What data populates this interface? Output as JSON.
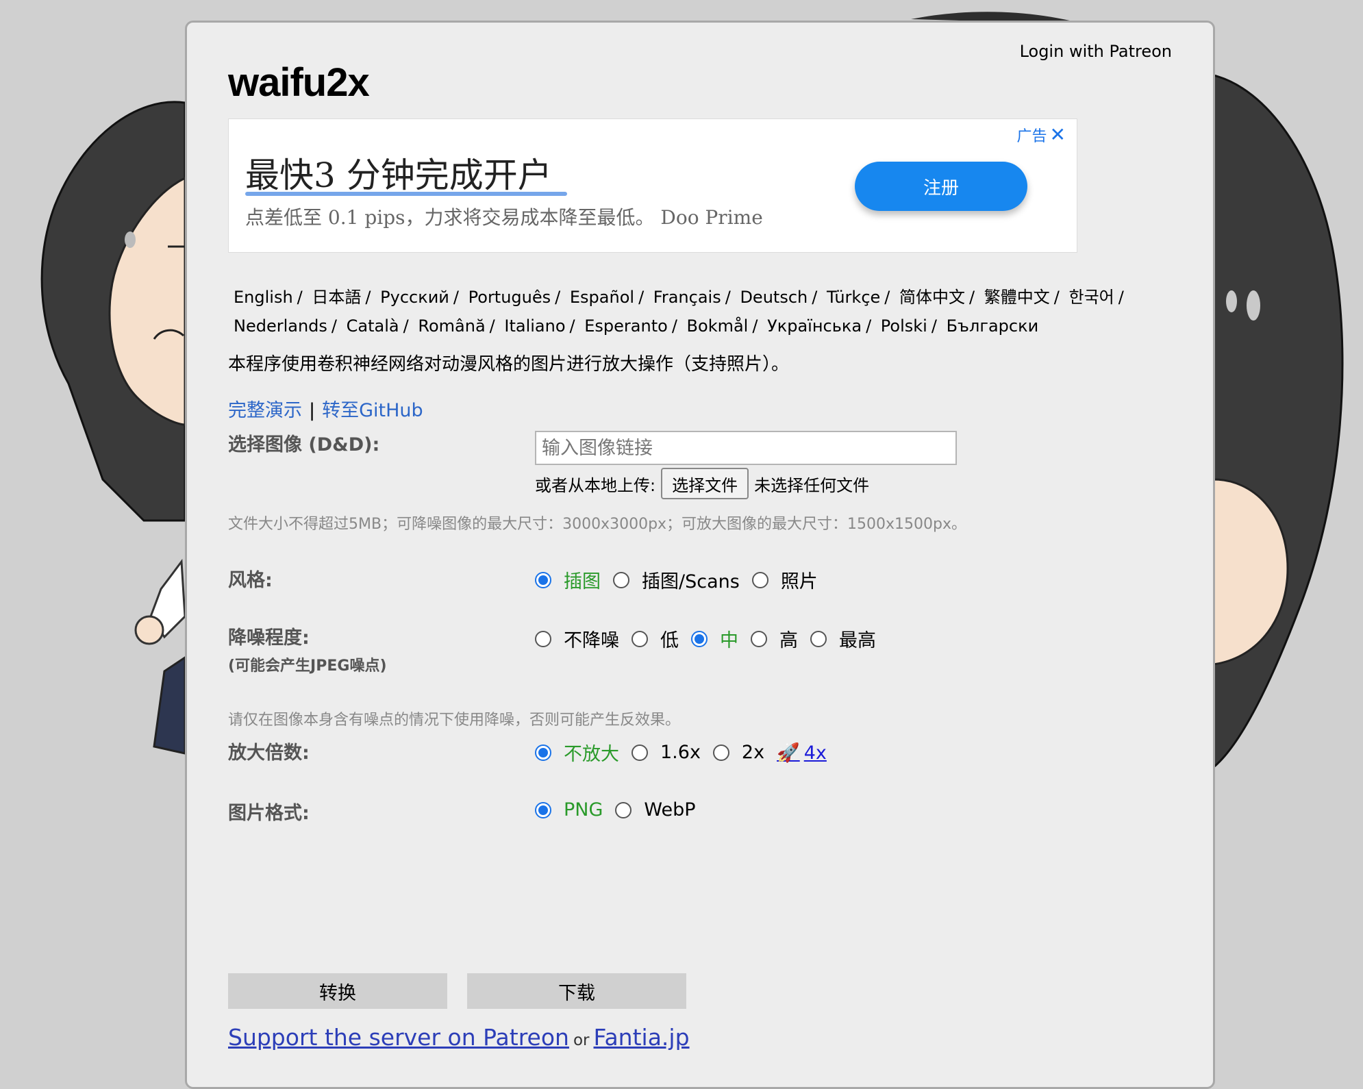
{
  "header": {
    "login_label": "Login with Patreon",
    "logo_text": "waifu2x"
  },
  "ad": {
    "tag_label": "广告",
    "close_glyph": "✕",
    "headline": "最快3 分钟完成开户",
    "subline": "点差低至 0.1 pips，力求将交易成本降至最低。 Doo Prime",
    "cta_label": "注册",
    "cta_color": "#1787ef"
  },
  "languages": [
    "English",
    "日本語",
    "Русский",
    "Português",
    "Español",
    "Français",
    "Deutsch",
    "Türkçe",
    "简体中文",
    "繁體中文",
    "한국어",
    "Nederlands",
    "Català",
    "Română",
    "Italiano",
    "Esperanto",
    "Bokmål",
    "Українська",
    "Polski",
    "Български"
  ],
  "description": "本程序使用卷积神经网络对动漫风格的图片进行放大操作（支持照片）。",
  "links": {
    "demo": "完整演示",
    "separator": "|",
    "github": "转至GitHub"
  },
  "image_select": {
    "label": "选择图像 (D&D):",
    "url_placeholder": "输入图像链接",
    "upload_prefix": "或者从本地上传:",
    "file_button": "选择文件",
    "file_status": "未选择任何文件",
    "limits_note": "文件大小不得超过5MB；可降噪图像的最大尺寸：3000x3000px；可放大图像的最大尺寸：1500x1500px。"
  },
  "style": {
    "label": "风格:",
    "options": [
      {
        "label": "插图",
        "selected": true
      },
      {
        "label": "插图/Scans",
        "selected": false
      },
      {
        "label": "照片",
        "selected": false
      }
    ]
  },
  "noise": {
    "label": "降噪程度:",
    "sublabel": "(可能会产生JPEG噪点)",
    "options": [
      {
        "label": "不降噪",
        "selected": false
      },
      {
        "label": "低",
        "selected": false
      },
      {
        "label": "中",
        "selected": true
      },
      {
        "label": "高",
        "selected": false
      },
      {
        "label": "最高",
        "selected": false
      }
    ],
    "note": "请仅在图像本身含有噪点的情况下使用降噪，否则可能产生反效果。"
  },
  "scale": {
    "label": "放大倍数:",
    "options": [
      {
        "label": "不放大",
        "selected": true
      },
      {
        "label": "1.6x",
        "selected": false
      },
      {
        "label": "2x",
        "selected": false
      }
    ],
    "premium_glyph": "🚀",
    "premium_label": "4x"
  },
  "format": {
    "label": "图片格式:",
    "options": [
      {
        "label": "PNG",
        "selected": true
      },
      {
        "label": "WebP",
        "selected": false
      }
    ]
  },
  "actions": {
    "convert": "转换",
    "download": "下载"
  },
  "support": {
    "patreon": "Support the server on Patreon",
    "or": "or",
    "fantia": "Fantia.jp"
  },
  "colors": {
    "selected_radio": "#1a73e8",
    "selected_label": "#2a9a2a",
    "link": "#2c66c8"
  }
}
